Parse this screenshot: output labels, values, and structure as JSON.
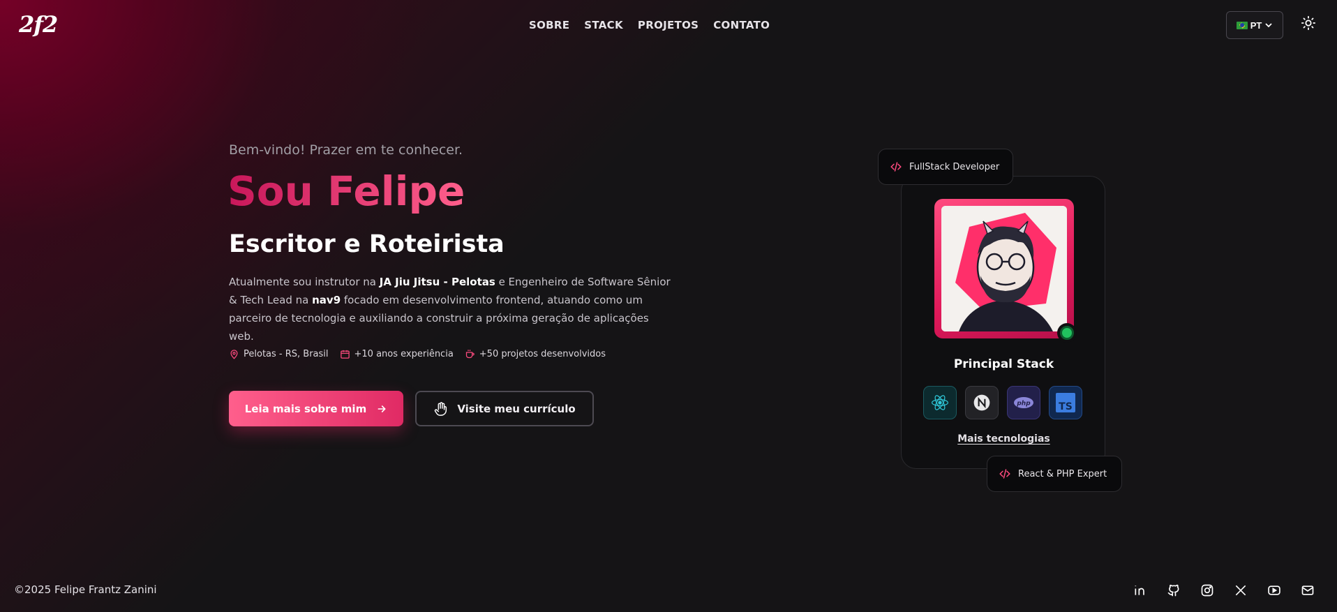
{
  "header": {
    "logo": "2f2",
    "nav": [
      "SOBRE",
      "STACK",
      "PROJETOS",
      "CONTATO"
    ],
    "language": "PT"
  },
  "hero": {
    "greeting": "Bem-vindo! Prazer em te conhecer.",
    "name": "Sou Felipe",
    "role": "Escritor e Roteirista",
    "desc_1": "Atualmente sou instrutor na ",
    "desc_bold_1": "JA Jiu Jitsu - Pelotas",
    "desc_2": " e Engenheiro de Software Sênior & Tech Lead na ",
    "desc_bold_2": "nav9",
    "desc_3": " focado em desenvolvimento frontend, atuando como um parceiro de tecnologia e auxiliando a construir a próxima geração de aplicações web.",
    "meta": {
      "location": "Pelotas - RS, Brasil",
      "experience": "+10 anos experiência",
      "projects": "+50 projetos desenvolvidos"
    },
    "primary_button": "Leia mais sobre mim",
    "secondary_button": "Visite meu currículo"
  },
  "card": {
    "badge_top": "FullStack Developer",
    "badge_bottom": "React & PHP Expert",
    "stack_title": "Principal Stack",
    "more_link": "Mais tecnologias",
    "technologies": [
      "react-icon",
      "nextjs-icon",
      "php-icon",
      "typescript-icon"
    ]
  },
  "footer": {
    "copyright": "©2025 Felipe Frantz Zanini",
    "socials": [
      "linkedin-icon",
      "github-icon",
      "instagram-icon",
      "x-icon",
      "youtube-icon",
      "mail-icon"
    ]
  },
  "colors": {
    "accent": "#ff4b7f",
    "accent_dark": "#c8175a",
    "background": "#151416",
    "online": "#21c25e"
  }
}
